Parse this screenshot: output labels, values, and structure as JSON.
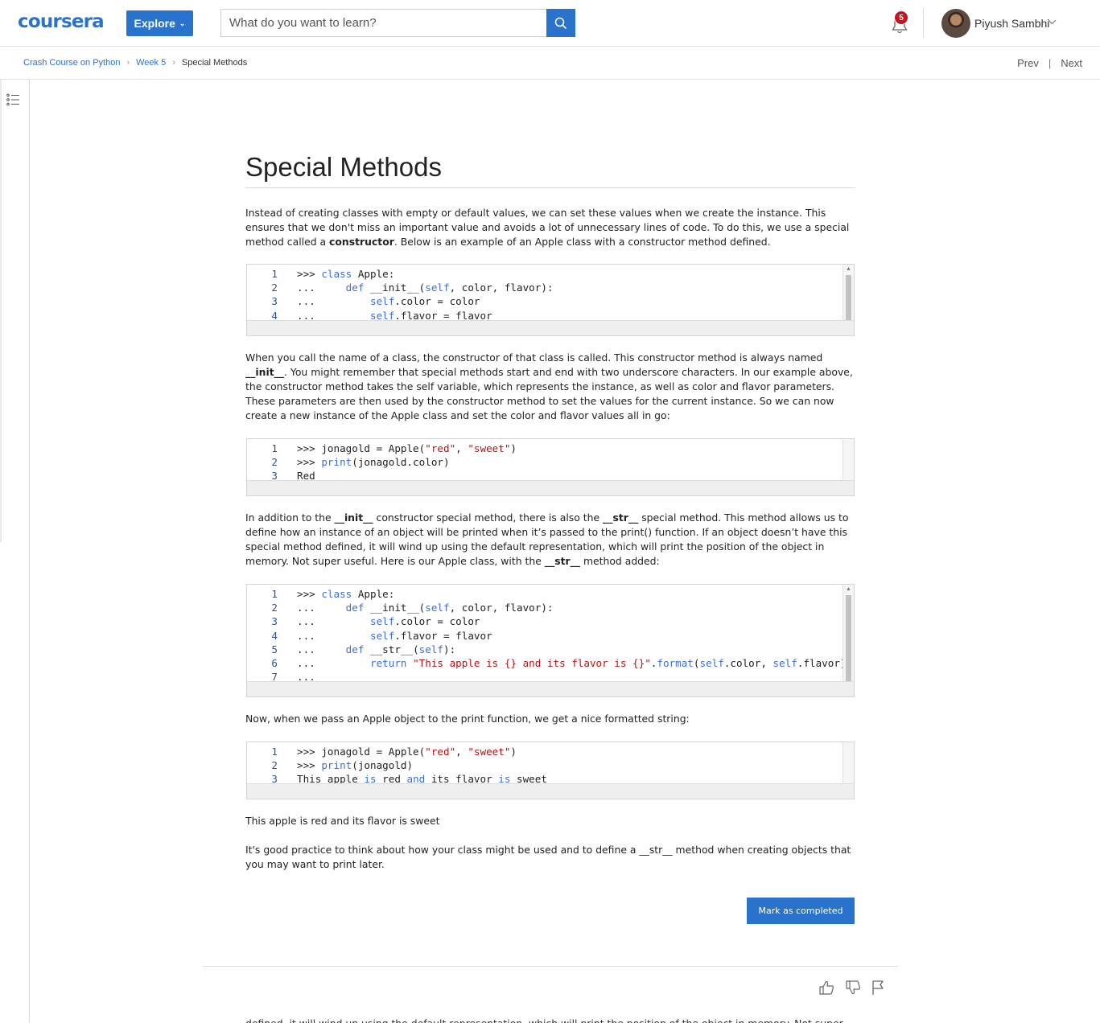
{
  "header": {
    "logo": "coursera",
    "explore_label": "Explore",
    "search_placeholder": "What do you want to learn?",
    "notification_count": "5",
    "user_name": "Piyush Sambhi"
  },
  "breadcrumb": {
    "items": [
      "Crash Course on Python",
      "Week 5"
    ],
    "current": "Special Methods",
    "prev": "Prev",
    "separator": "|",
    "next": "Next"
  },
  "page": {
    "title": "Special Methods",
    "para1": "Instead of creating classes with empty or default values, we can set these values when we create the instance. This ensures that we don't miss an important value and avoids a lot of unnecessary lines of code. To do this, we use a special method called a <b>constructor</b>. Below is an example of an Apple class with a constructor method defined.",
    "para2": "When you call the name of a class, the constructor of that class is called. This constructor method is always named <b>__init__</b>. You might remember that special methods start and end with two underscore characters. In our example above, the constructor method takes the self variable, which represents the instance, as well as color and flavor parameters. These parameters are then used by the constructor method to set the values for the current instance. So we can now create a new instance of the Apple class and set the color and flavor values all in go:",
    "para3": "In addition to the <b>__init__</b> constructor special method, there is also the <b>__str__</b> special method. This method allows us to define how an instance of an object will be printed when it’s passed to the print() function. If an object doesn’t have this special method defined, it will wind up using the default representation, which will print the position of the object in memory. Not super useful. Here is our Apple class, with the <b>__str__</b> method added:",
    "para4": "Now, when we pass an Apple object to the print function, we get a nice formatted string:",
    "para5": "This apple is red and its flavor is sweet",
    "para6": "It's good practice to think about how your class might be used and to define a __str__ method when creating objects that you may want to print later.",
    "complete_label": "Mark as completed",
    "cut_text": "defined, it will wind up using the default representation, which will print the position of the object in memory. Not super useful."
  },
  "code_blocks": [
    [
      ">>> <span class=\"kw\">class</span> Apple:",
      "...     <span class=\"kw\">def</span> __init__(<span class=\"kw\">self</span>, color, flavor):",
      "...         <span class=\"kw\">self</span>.color = color",
      "...         <span class=\"kw\">self</span>.flavor = flavor"
    ],
    [
      ">>> jonagold = Apple(<span class=\"str\">\"red\"</span>, <span class=\"str\">\"sweet\"</span>)",
      ">>> <span class=\"fn\">print</span>(jonagold.color)",
      "Red"
    ],
    [
      ">>> <span class=\"kw\">class</span> Apple:",
      "...     <span class=\"kw\">def</span> __init__(<span class=\"kw\">self</span>, color, flavor):",
      "...         <span class=\"kw\">self</span>.color = color",
      "...         <span class=\"kw\">self</span>.flavor = flavor",
      "...     <span class=\"kw\">def</span> __str__(<span class=\"kw\">self</span>):",
      "...         <span class=\"kw\">return</span> <span class=\"str\">\"This apple is {} and its flavor is {}\"</span>.<span class=\"fn\">format</span>(<span class=\"kw\">self</span>.color, <span class=\"kw\">self</span>.flavor)",
      "..."
    ],
    [
      ">>> jonagold = Apple(<span class=\"str\">\"red\"</span>, <span class=\"str\">\"sweet\"</span>)",
      ">>> <span class=\"fn\">print</span>(jonagold)",
      "This apple <span class=\"kw\">is</span> red <span class=\"kw\">and</span> its flavor <span class=\"kw\">is</span> sweet"
    ]
  ],
  "icons": {
    "search": "search-icon",
    "bell": "bell-icon",
    "toc": "list-icon",
    "like": "thumbs-up-icon",
    "dislike": "thumbs-down-icon",
    "flag": "flag-icon"
  },
  "colors": {
    "brand_blue": "#2a73cc",
    "badge_red": "#c4161c",
    "keyword_blue": "#3c6fd6",
    "string_red": "#b41414"
  }
}
